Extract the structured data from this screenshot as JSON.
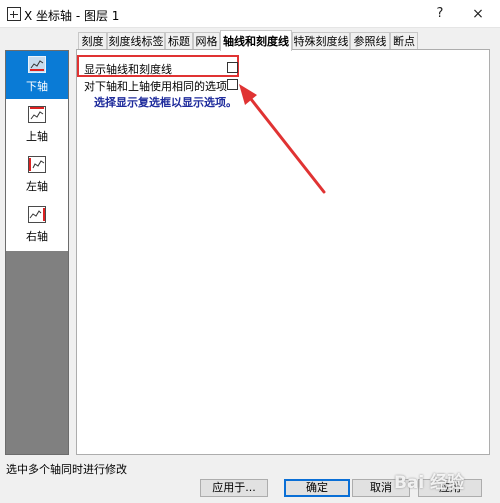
{
  "window": {
    "title": "X 坐标轴 - 图层 1",
    "help": "?",
    "close": "×"
  },
  "sidebar": {
    "items": [
      {
        "label": "下轴",
        "selected": true,
        "icon": "axis-bottom-icon"
      },
      {
        "label": "上轴",
        "selected": false,
        "icon": "axis-top-icon"
      },
      {
        "label": "左轴",
        "selected": false,
        "icon": "axis-left-icon"
      },
      {
        "label": "右轴",
        "selected": false,
        "icon": "axis-right-icon"
      }
    ]
  },
  "tabs": [
    {
      "label": "刻度"
    },
    {
      "label": "刻度线标签"
    },
    {
      "label": "标题"
    },
    {
      "label": "网格"
    },
    {
      "label": "轴线和刻度线",
      "active": true
    },
    {
      "label": "特殊刻度线"
    },
    {
      "label": "参照线"
    },
    {
      "label": "断点"
    }
  ],
  "panel": {
    "show_axis_label": "显示轴线和刻度线",
    "show_axis_checked": false,
    "same_options_label": "对下轴和上轴使用相同的选项",
    "same_options_checked": false,
    "hint": "选择显示复选框以显示选项。"
  },
  "status": "选中多个轴同时进行修改",
  "buttons": {
    "apply_to": "应用于...",
    "ok": "确定",
    "cancel": "取消",
    "apply": "应用"
  },
  "watermark": "Bai 经验",
  "colors": {
    "selected": "#0a7bd6",
    "hint_text": "#1e2b9c",
    "annotation": "#e03333"
  }
}
